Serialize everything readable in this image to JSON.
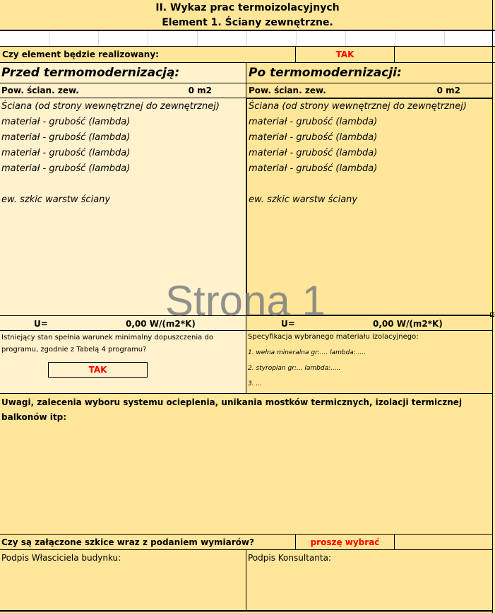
{
  "header": {
    "title_line1": "II. Wykaz prac termoizolacyjnych",
    "title_line2": "Element 1. Ściany zewnętrzne."
  },
  "realization": {
    "question": "Czy element będzie realizowany:",
    "answer": "TAK"
  },
  "before": {
    "heading": "Przed termomodernizacją:",
    "area_label": "Pow. ścian. zew.",
    "area_value": "0 m2",
    "wall_line": "Ściana (od strony wewnętrznej do zewnętrznej)",
    "material_lines": [
      "materiał - grubość (lambda)",
      "materiał - grubość (lambda)",
      "materiał - grubość (lambda)",
      "materiał - grubość (lambda)"
    ],
    "sketch_label": "ew. szkic warstw ściany",
    "u_label": "U=",
    "u_value": "0,00 W/(m2*K)",
    "condition_text_line1": "Istniejący stan spełnia warunek minimalny dopuszczenia do",
    "condition_text_line2": "programu, zgodnie z Tabelą 4 programu?",
    "condition_answer": "TAK"
  },
  "after": {
    "heading": "Po termomodernizacji:",
    "area_label": "Pow. ścian. zew.",
    "area_value": "0 m2",
    "wall_line": "Ściana (od strony wewnętrznej do zewnętrznej)",
    "material_lines": [
      "materiał - grubość (lambda)",
      "materiał - grubość (lambda)",
      "materiał - grubość (lambda)",
      "materiał - grubość (lambda)"
    ],
    "sketch_label": "ew. szkic warstw ściany",
    "u_label": "U=",
    "u_value": "0,00 W/(m2*K)",
    "spec_title": "Specyfikacja wybranego materiału izolacyjnego:",
    "spec_items": [
      "1. wełna mineralna gr:.... lambda:.....",
      "2. styropian gr:... lambda:.....",
      "3. ..."
    ]
  },
  "remarks": {
    "line1": "Uwagi, zalecenia wyboru systemu ocieplenia, unikania mostków termicznych, izolacji termicznej",
    "line2": "balkonów itp:"
  },
  "sketches": {
    "question": "Czy są załączone szkice wraz z podaniem wymiarów?",
    "answer": "proszę wybrać"
  },
  "signatures": {
    "owner": "Podpis Własciciela budynku:",
    "consultant": "Podpis Konsultanta:"
  },
  "watermark": "Strona 1"
}
